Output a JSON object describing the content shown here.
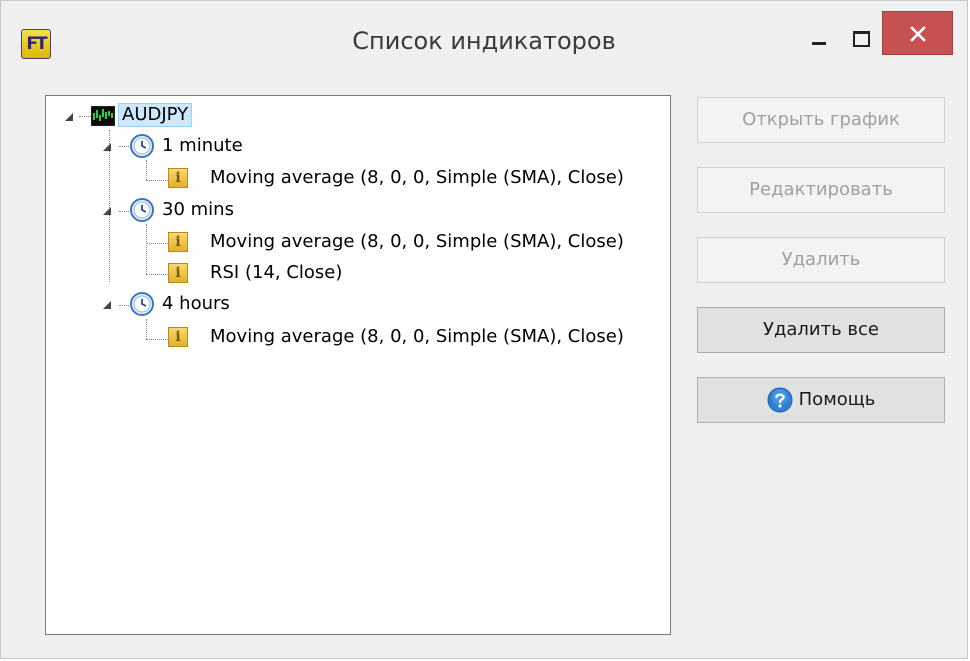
{
  "window": {
    "title": "Список индикаторов",
    "app_icon_text": "FT",
    "close_color": "#c75050"
  },
  "tree": {
    "root": {
      "label": "AUDJPY",
      "icon": "chart-icon",
      "selected": true
    },
    "groups": [
      {
        "label": "1 minute",
        "icon": "clock-icon",
        "items": [
          {
            "label": "Moving average (8, 0, 0, Simple (SMA), Close)",
            "icon": "indicator-icon"
          }
        ]
      },
      {
        "label": "30 mins",
        "icon": "clock-icon",
        "items": [
          {
            "label": "Moving average (8, 0, 0, Simple (SMA), Close)",
            "icon": "indicator-icon"
          },
          {
            "label": "RSI (14, Close)",
            "icon": "indicator-icon"
          }
        ]
      },
      {
        "label": "4 hours",
        "icon": "clock-icon",
        "items": [
          {
            "label": "Moving average (8, 0, 0, Simple (SMA), Close)",
            "icon": "indicator-icon"
          }
        ]
      }
    ]
  },
  "buttons": {
    "open_chart": {
      "label": "Открыть график",
      "enabled": false
    },
    "edit": {
      "label": "Редактировать",
      "enabled": false
    },
    "delete": {
      "label": "Удалить",
      "enabled": false
    },
    "delete_all": {
      "label": "Удалить все",
      "enabled": true
    },
    "help": {
      "label": "Помощь",
      "enabled": true,
      "icon": "help-icon"
    }
  }
}
